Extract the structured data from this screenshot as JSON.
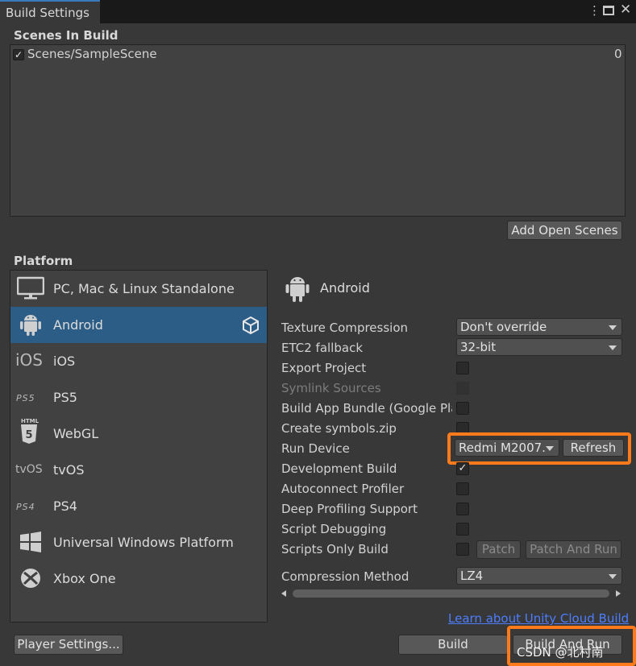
{
  "window": {
    "tab_title": "Build Settings",
    "icons": [
      "more-vert-icon",
      "maximize-icon",
      "close-icon"
    ]
  },
  "scenes": {
    "section_label": "Scenes In Build",
    "items": [
      {
        "name": "Scenes/SampleScene",
        "index": "0",
        "checked": true
      }
    ],
    "add_open_scenes_label": "Add Open Scenes"
  },
  "platform": {
    "section_label": "Platform",
    "items": [
      {
        "label": "PC, Mac & Linux Standalone",
        "icon": "monitor-icon"
      },
      {
        "label": "Android",
        "icon": "android-icon",
        "selected": true,
        "active_badge": "unity-logo-icon"
      },
      {
        "label": "iOS",
        "icon": "ios-logo-icon",
        "logo_text": "iOS"
      },
      {
        "label": "PS5",
        "icon": "ps5-logo-icon",
        "logo_text": "PS5"
      },
      {
        "label": "WebGL",
        "icon": "html5-icon",
        "logo_text": "HTML"
      },
      {
        "label": "tvOS",
        "icon": "tvos-logo-icon",
        "logo_text": "tvOS"
      },
      {
        "label": "PS4",
        "icon": "ps4-logo-icon",
        "logo_text": "PS4"
      },
      {
        "label": "Universal Windows Platform",
        "icon": "windows-logo-icon"
      },
      {
        "label": "Xbox One",
        "icon": "xbox-logo-icon"
      }
    ]
  },
  "settings": {
    "header": "Android",
    "texture_compression": {
      "label": "Texture Compression",
      "value": "Don't override"
    },
    "etc2_fallback": {
      "label": "ETC2 fallback",
      "value": "32-bit"
    },
    "export_project": {
      "label": "Export Project",
      "checked": false
    },
    "symlink_sources": {
      "label": "Symlink Sources",
      "checked": false,
      "disabled": true
    },
    "build_app_bundle": {
      "label": "Build App Bundle (Google Play",
      "checked": false
    },
    "create_symbols": {
      "label": "Create symbols.zip",
      "checked": false
    },
    "run_device": {
      "label": "Run Device",
      "value": "Redmi M2007.",
      "refresh_label": "Refresh"
    },
    "development_build": {
      "label": "Development Build",
      "checked": true
    },
    "autoconnect_profiler": {
      "label": "Autoconnect Profiler",
      "checked": false
    },
    "deep_profiling": {
      "label": "Deep Profiling Support",
      "checked": false
    },
    "script_debugging": {
      "label": "Script Debugging",
      "checked": false
    },
    "scripts_only_build": {
      "label": "Scripts Only Build",
      "checked": false,
      "patch_label": "Patch",
      "patch_and_run_label": "Patch And Run"
    },
    "compression_method": {
      "label": "Compression Method",
      "value": "LZ4"
    },
    "cloud_build_link": "Learn about Unity Cloud Build"
  },
  "footer": {
    "player_settings_label": "Player Settings...",
    "build_label": "Build",
    "build_and_run_label": "Build And Run",
    "watermark": "CSDN @北村南"
  },
  "colors": {
    "background": "#383838",
    "panel": "#414141",
    "selection": "#2c5d87",
    "highlight": "#ff7a1a",
    "link": "#4c7eff",
    "tab_accent": "#3a79bb"
  }
}
